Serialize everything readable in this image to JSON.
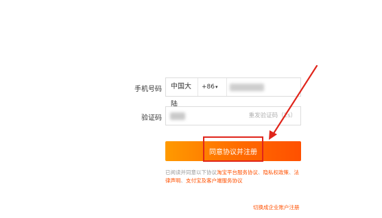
{
  "form": {
    "phone_label": "手机号码",
    "region": "中国大陆",
    "country_code": "+86",
    "caret": "▾",
    "code_label": "验证码",
    "resend": "重发验证码（2s）",
    "submit_label": "同意协议并注册"
  },
  "agreement": {
    "prefix": "已阅读并同意以下协议",
    "link1": "淘宝平台服务协议",
    "sep1": "、",
    "link2": "隐私权政策",
    "sep2": "、",
    "link3": "法律声明",
    "sep3": "、",
    "link4": "支付宝及客户端服务协议"
  },
  "enterprise_link": "切换成企业账户注册",
  "colors": {
    "accent": "#ff5000",
    "button_start": "#ff9a00",
    "button_end": "#ff5000",
    "annotation": "#e0251b"
  }
}
